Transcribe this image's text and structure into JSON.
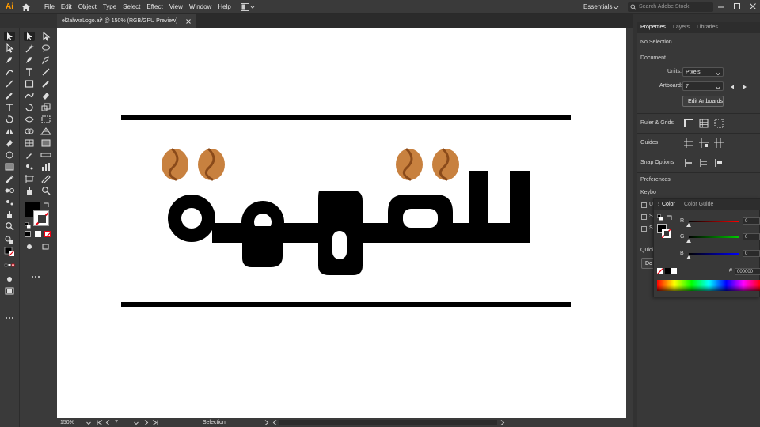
{
  "app": {
    "logo": "Ai",
    "menus": [
      "File",
      "Edit",
      "Object",
      "Type",
      "Select",
      "Effect",
      "View",
      "Window",
      "Help"
    ],
    "workspace": "Essentials",
    "search_placeholder": "Search Adobe Stock"
  },
  "document": {
    "tab_title": "el2ahwaLogo.ai* @ 150% (RGB/GPU Preview)"
  },
  "artwork": {
    "arabic_text": "القهوة",
    "text_color": "#000000",
    "bean_color": "#c8813f",
    "bean_stripe_color": "#8a4a1a"
  },
  "status": {
    "zoom": "150%",
    "artboard_number": "7",
    "tool": "Selection"
  },
  "panel": {
    "tabs": [
      "Properties",
      "Layers",
      "Libraries"
    ],
    "no_selection": "No Selection",
    "document_label": "Document",
    "units_label": "Units:",
    "units_value": "Pixels",
    "artboard_label": "Artboard:",
    "artboard_value": "7",
    "edit_artboards": "Edit Artboards",
    "ruler_grids": "Ruler & Grids",
    "guides": "Guides",
    "snap_options": "Snap Options",
    "preferences": "Preferences",
    "keyboard_partial": "Keybo",
    "check_u": "U",
    "check_s1": "Sc",
    "check_s2": "Sc",
    "quick_partial": "Quick",
    "doc_partial": "Do"
  },
  "color_panel": {
    "tabs": [
      "Color",
      "Color Guide"
    ],
    "r_label": "R",
    "g_label": "G",
    "b_label": "B",
    "r_value": "0",
    "g_value": "0",
    "b_value": "0",
    "hex_label": "#",
    "hex_value": "000000",
    "fill_color": "#000000"
  }
}
